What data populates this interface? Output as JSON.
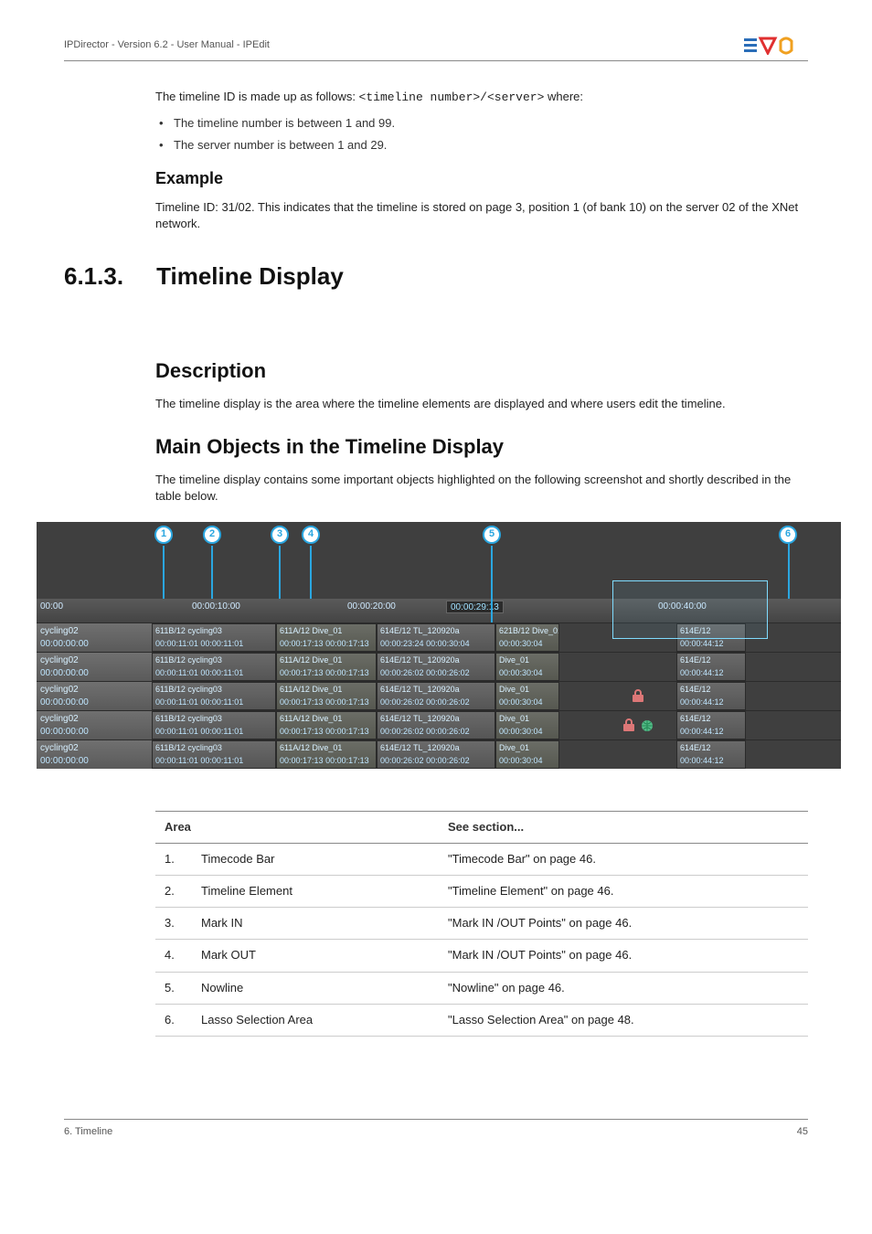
{
  "header": {
    "left": "IPDirector - Version 6.2 - User Manual - IPEdit"
  },
  "intro": {
    "line1_pre": "The timeline ID is made up as follows: ",
    "line1_code": "<timeline number>/<server>",
    "line1_post": " where:",
    "bullets": [
      "The timeline number is between 1 and 99.",
      "The server number is between 1 and 29."
    ],
    "example_h": "Example",
    "example_text": "Timeline ID: 31/02. This indicates that the timeline is stored on page 3, position 1 (of bank 10) on the server 02 of the XNet network."
  },
  "h1": {
    "num": "6.1.3.",
    "title": "Timeline Display"
  },
  "desc": {
    "h": "Description",
    "text": "The timeline display is the area where the timeline elements are displayed and where users edit the timeline."
  },
  "mainobj": {
    "h": "Main Objects in the Timeline Display",
    "text": "The timeline display contains some important objects highlighted on the following screenshot and shortly described in the table below."
  },
  "ruler": {
    "labels": [
      "00:00",
      "00:00:10:00",
      "00:00:20:00",
      "00:00:40:00"
    ],
    "nowline": "00:00:29:13"
  },
  "tracks": [
    {
      "row": 0,
      "name": "cycling02",
      "time": "00:00:00:00"
    },
    {
      "row": 1,
      "name": "cycling02",
      "time": "00:00:00:00"
    },
    {
      "row": 2,
      "name": "cycling02",
      "time": "00:00:00:00"
    },
    {
      "row": 3,
      "name": "cycling02",
      "time": "00:00:00:00"
    },
    {
      "row": 4,
      "name": "cycling02",
      "time": "00:00:00:00"
    }
  ],
  "clips": {
    "a_top1": "611B/12",
    "a_top2": "cycling03",
    "a_bot1": "00:00:11:01",
    "a_bot2": "00:00:11:01",
    "b_top1": "611A/12",
    "b_top2": "Dive_01",
    "b_bot1": "00:00:17:13",
    "b_bot2": "00:00:17:13",
    "c_top1": "614E/12",
    "c_top2": "TL_120920a",
    "c_bot1": "00:00:26:02",
    "c_bot2": "00:00:26:02",
    "d_top1": "621B/12",
    "d_top2": "Dive_01",
    "d_bot2": "00:00:30:04",
    "e_top": "614E/12",
    "e_bot": "00:00:44:12",
    "c_first_bot1": "00:00:23:24",
    "c_first_bot2": "00:00:30:04"
  },
  "markers": {
    "1": "1",
    "2": "2",
    "3": "3",
    "4": "4",
    "5": "5",
    "6": "6"
  },
  "table": {
    "head_area": "Area",
    "head_see": "See section...",
    "rows": [
      {
        "n": "1.",
        "name": "Timecode Bar",
        "see": "\"Timecode Bar\" on page 46."
      },
      {
        "n": "2.",
        "name": "Timeline Element",
        "see": "\"Timeline Element\" on page 46."
      },
      {
        "n": "3.",
        "name": "Mark IN",
        "see": "\"Mark IN /OUT Points\" on page 46."
      },
      {
        "n": "4.",
        "name": "Mark OUT",
        "see": "\"Mark IN /OUT Points\" on page 46."
      },
      {
        "n": "5.",
        "name": "Nowline",
        "see": "\"Nowline\" on page 46."
      },
      {
        "n": "6.",
        "name": "Lasso Selection Area",
        "see": "\"Lasso Selection Area\" on page 48."
      }
    ]
  },
  "footer": {
    "left": "6. Timeline",
    "right": "45"
  }
}
